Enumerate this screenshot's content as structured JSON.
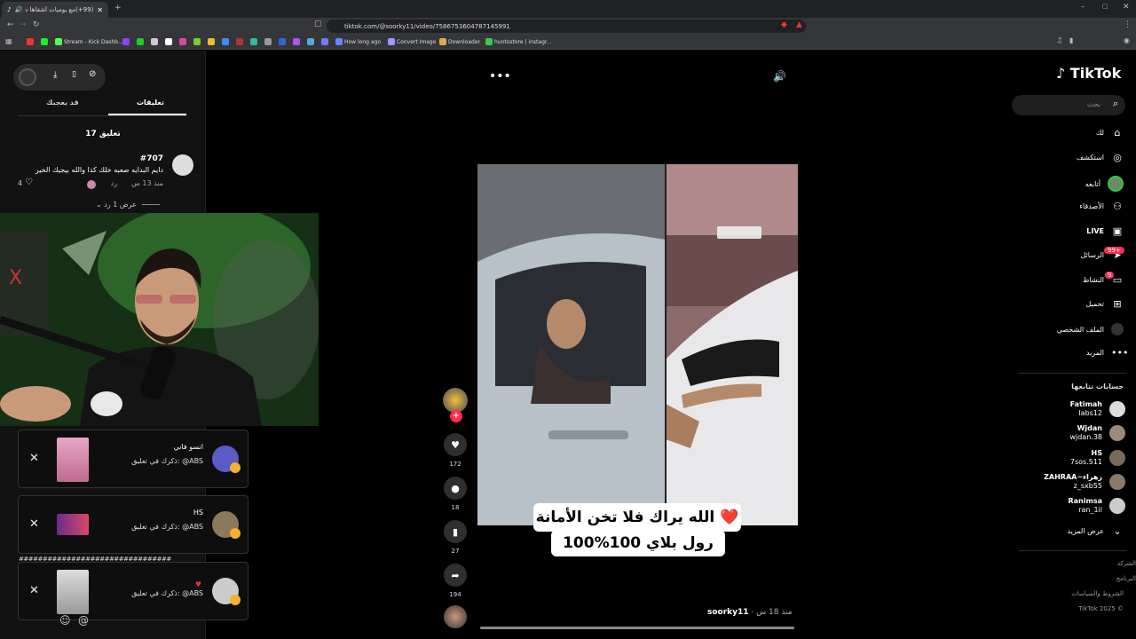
{
  "browser": {
    "tab_title": "(99+)مع يوميات أشقاها صبري",
    "url": "tiktok.com/@soorky11/video/7586753604787145991",
    "bookmarks": [
      "Stream - Kick Dashb...",
      "How long ago",
      "Convert Image",
      "Downloader",
      "huntostore | instagr..."
    ]
  },
  "comments_panel": {
    "tab_comments": "تعليقات",
    "tab_liked": "قد يعجبك",
    "comment_count": "17 تعليق",
    "comment": {
      "author": "#707",
      "text": "دايم البدايه صعبه خلك كذا والله بيجيك الخير",
      "time": "منذ 13 س",
      "reply": "رد",
      "likes": "4",
      "view_replies": "عرض 1 رد"
    }
  },
  "notifications": [
    {
      "name": "انسو فاني",
      "message": "ذكرك في تعليق: @ABS"
    },
    {
      "name": "HS",
      "message": "ذكرك في تعليق: @ABS"
    },
    {
      "name": "",
      "message": "ذكرك في تعليق: @ABS"
    }
  ],
  "hash_strip": "################################",
  "video": {
    "caption_line1": "الله يراك فلا تخن الأمانة ❤️",
    "caption_line2": "رول بلاي 100%100",
    "author": "soorky11",
    "posted": "منذ 18 س",
    "likes": "172",
    "comments": "18",
    "saves": "27",
    "shares": "194"
  },
  "nav": {
    "logo": "TikTok",
    "search_placeholder": "بحث",
    "items": {
      "for_you": "لك",
      "explore": "استكشف",
      "following": "أتابعه",
      "friends": "الأصدقاء",
      "live": "LIVE",
      "messages": "الرسائل",
      "messages_badge": "99+",
      "activity": "النشاط",
      "activity_badge": "9",
      "upload": "تحميل",
      "profile": "الملف الشخصي",
      "more": "المزيد"
    },
    "following_title": "حسابات تتابعها",
    "following_accounts": [
      {
        "name": "Fatimah",
        "handle": "labs12"
      },
      {
        "name": "Wjdan",
        "handle": "wjdan.38"
      },
      {
        "name": "HS",
        "handle": "7sos.511"
      },
      {
        "name": "ZAHRAA~زهراء",
        "handle": "z_sxb55"
      },
      {
        "name": "Ranimsa",
        "handle": "ran_1il"
      }
    ],
    "see_more": "عرض المزيد",
    "footer": [
      "الشركة",
      "البرنامج",
      "الشروط والسياسات",
      "TikTok 2025 ©"
    ]
  }
}
